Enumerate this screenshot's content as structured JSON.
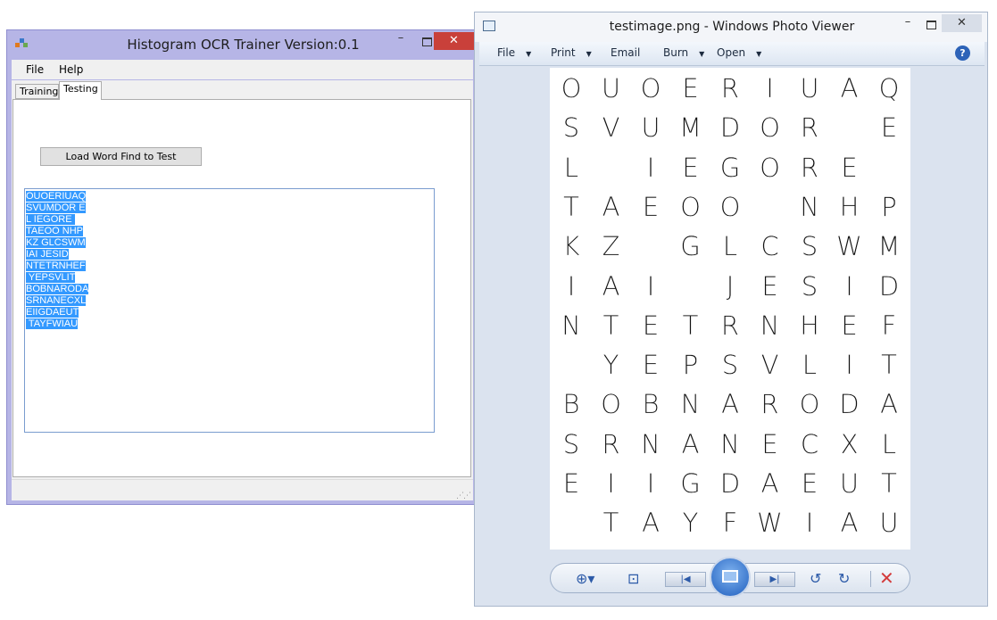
{
  "ocr_window": {
    "title": "Histogram OCR Trainer Version:0.1",
    "controls": {
      "minimize": "–",
      "close": "✕"
    },
    "menu": [
      "File",
      "Help"
    ],
    "tabs": [
      {
        "label": "Training",
        "active": false
      },
      {
        "label": "Testing",
        "active": true
      }
    ],
    "load_button_label": "Load Word Find to Test",
    "ocr_output_lines": [
      "OUOERIUAQ",
      "SVUMDOR E",
      "L IEGORE ",
      "TAEOO NHP",
      "KZ GLCSWM",
      "IAI JESID",
      "NTETRNHEF",
      " YEPSVLIT",
      "BOBNARODA",
      "SRNANECXL",
      "EIIGDAEUT",
      " TAYFWIAU"
    ],
    "selection_color": "#3399ff"
  },
  "viewer": {
    "title": "testimage.png - Windows Photo Viewer",
    "controls": {
      "minimize": "–",
      "close": "✕"
    },
    "toolbar": [
      {
        "label": "File",
        "has_dropdown": true
      },
      {
        "label": "Print",
        "has_dropdown": true
      },
      {
        "label": "Email",
        "has_dropdown": false
      },
      {
        "label": "Burn",
        "has_dropdown": true
      },
      {
        "label": "Open",
        "has_dropdown": true
      }
    ],
    "help_label": "?",
    "image_grid": [
      [
        "O",
        "U",
        "O",
        "E",
        "R",
        "I",
        "U",
        "A",
        "Q"
      ],
      [
        "S",
        "V",
        "U",
        "M",
        "D",
        "O",
        "R",
        "",
        "E"
      ],
      [
        "L",
        "",
        "I",
        "E",
        "G",
        "O",
        "R",
        "E",
        ""
      ],
      [
        "T",
        "A",
        "E",
        "O",
        "O",
        "",
        "N",
        "H",
        "P"
      ],
      [
        "K",
        "Z",
        "",
        "G",
        "L",
        "C",
        "S",
        "W",
        "M"
      ],
      [
        "I",
        "A",
        "I",
        "",
        "J",
        "E",
        "S",
        "I",
        "D"
      ],
      [
        "N",
        "T",
        "E",
        "T",
        "R",
        "N",
        "H",
        "E",
        "F"
      ],
      [
        "",
        "Y",
        "E",
        "P",
        "S",
        "V",
        "L",
        "I",
        "T"
      ],
      [
        "B",
        "O",
        "B",
        "N",
        "A",
        "R",
        "O",
        "D",
        "A"
      ],
      [
        "S",
        "R",
        "N",
        "A",
        "N",
        "E",
        "C",
        "X",
        "L"
      ],
      [
        "E",
        "I",
        "I",
        "G",
        "D",
        "A",
        "E",
        "U",
        "T"
      ],
      [
        "",
        "T",
        "A",
        "Y",
        "F",
        "W",
        "I",
        "A",
        "U"
      ]
    ],
    "bottom_controls": [
      "zoom-icon",
      "fit-icon",
      "previous-icon",
      "slideshow-icon",
      "next-icon",
      "rotate-left-icon",
      "rotate-right-icon",
      "delete-icon"
    ]
  }
}
